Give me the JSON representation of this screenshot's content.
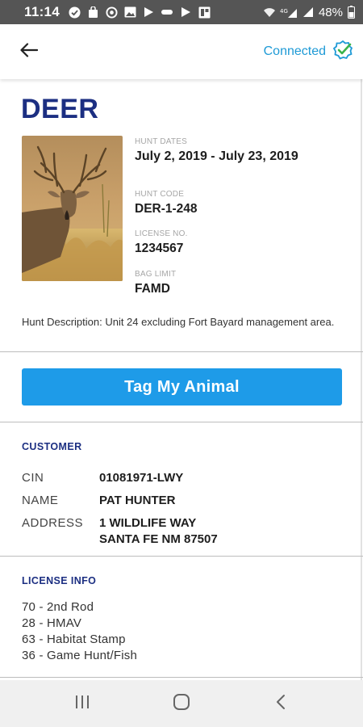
{
  "status_bar": {
    "time": "11:14",
    "battery": "48%",
    "icons": [
      "check-circle-icon",
      "bag-icon",
      "at-icon",
      "image-icon",
      "play-icon",
      "minus-icon",
      "play-icon",
      "gallery-icon",
      "wifi-icon",
      "lte-signal-icon",
      "signal-icon",
      "battery-icon"
    ]
  },
  "app_bar": {
    "back_icon": "arrow-left-icon",
    "status_text": "Connected",
    "status_icon": "check-badge-icon",
    "accent_color": "#1e9ad6"
  },
  "hunt": {
    "title": "DEER",
    "image": "deer-photo",
    "dates_label": "HUNT DATES",
    "dates_value": "July 2, 2019 - July 23, 2019",
    "code_label": "HUNT CODE",
    "code_value": "DER-1-248",
    "license_label": "LICENSE NO.",
    "license_value": "1234567",
    "bag_label": "BAG LIMIT",
    "bag_value": "FAMD",
    "description": "Hunt Description: Unit 24 excluding Fort Bayard management area."
  },
  "actions": {
    "tag_label": "Tag My Animal",
    "button_color": "#1e9be8"
  },
  "customer": {
    "section_title": "CUSTOMER",
    "cin_label": "CIN",
    "cin_value": "01081971-LWY",
    "name_label": "NAME",
    "name_value": "PAT HUNTER",
    "address_label": "ADDRESS",
    "address_line1": "1 WILDLIFE WAY",
    "address_line2": "SANTA FE NM 87507"
  },
  "license_info": {
    "section_title": "LICENSE INFO",
    "items": [
      "70 - 2nd Rod",
      "28 - HMAV",
      "63 - Habitat Stamp",
      "36 - Game Hunt/Fish"
    ]
  },
  "nav_bar": {
    "buttons": [
      "recent-apps-icon",
      "home-icon",
      "back-icon"
    ]
  }
}
